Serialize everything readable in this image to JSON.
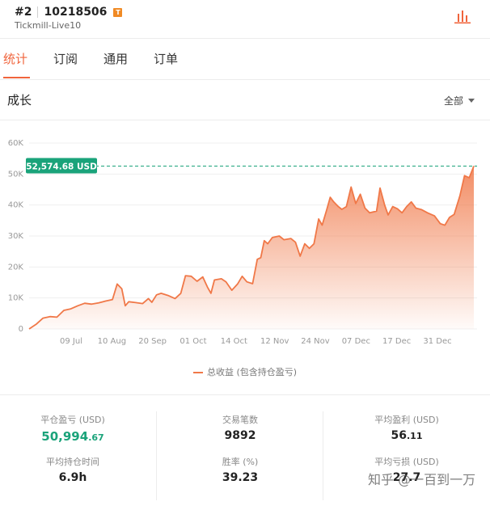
{
  "header": {
    "rank": "#2",
    "account_number": "10218506",
    "badge": "T",
    "broker": "Tickmill-Live10",
    "chart_icon": "bar-chart-icon"
  },
  "tabs": [
    {
      "label": "统计",
      "active": true
    },
    {
      "label": "订阅",
      "active": false
    },
    {
      "label": "通用",
      "active": false
    },
    {
      "label": "订单",
      "active": false
    }
  ],
  "section": {
    "title": "成长",
    "filter": "全部"
  },
  "colors": {
    "accent": "#f0643c",
    "line": "#f07848",
    "badge_bg": "#1aa37a",
    "gain": "#1aa37a"
  },
  "chart_data": {
    "type": "area",
    "current_value_label": "52,574.68 USD",
    "current_value": 52574.68,
    "ylim": [
      0,
      60000
    ],
    "yticks": [
      "0",
      "10K",
      "20K",
      "30K",
      "40K",
      "50K",
      "60K"
    ],
    "xtick_labels": [
      "09 Jul",
      "10 Aug",
      "20 Sep",
      "01 Oct",
      "14 Oct",
      "12 Nov",
      "24 Nov",
      "07 Dec",
      "17 Dec",
      "31 Dec"
    ],
    "legend": "总收益 (包含持仓盈亏)",
    "grid": true,
    "series": [
      {
        "name": "总收益 (包含持仓盈亏)",
        "points": [
          [
            0,
            0
          ],
          [
            0.6,
            1500
          ],
          [
            1.2,
            3500
          ],
          [
            1.8,
            4000
          ],
          [
            2.4,
            3800
          ],
          [
            3.0,
            6000
          ],
          [
            3.6,
            6500
          ],
          [
            4.2,
            7500
          ],
          [
            4.8,
            8300
          ],
          [
            5.4,
            8000
          ],
          [
            6.0,
            8400
          ],
          [
            6.6,
            9000
          ],
          [
            7.2,
            9500
          ],
          [
            7.6,
            14500
          ],
          [
            8.0,
            13000
          ],
          [
            8.3,
            7500
          ],
          [
            8.6,
            8800
          ],
          [
            9.2,
            8500
          ],
          [
            9.8,
            8200
          ],
          [
            10.3,
            9800
          ],
          [
            10.6,
            8600
          ],
          [
            11.0,
            11000
          ],
          [
            11.4,
            11500
          ],
          [
            12.0,
            10800
          ],
          [
            12.6,
            9800
          ],
          [
            13.1,
            11500
          ],
          [
            13.5,
            17200
          ],
          [
            14.0,
            17000
          ],
          [
            14.5,
            15400
          ],
          [
            15.0,
            16800
          ],
          [
            15.4,
            13500
          ],
          [
            15.7,
            11500
          ],
          [
            16.0,
            15800
          ],
          [
            16.6,
            16200
          ],
          [
            17.0,
            15200
          ],
          [
            17.5,
            12500
          ],
          [
            18.0,
            14500
          ],
          [
            18.4,
            17000
          ],
          [
            18.8,
            15200
          ],
          [
            19.3,
            14600
          ],
          [
            19.7,
            22500
          ],
          [
            20.0,
            23000
          ],
          [
            20.3,
            28500
          ],
          [
            20.6,
            27500
          ],
          [
            21.0,
            29500
          ],
          [
            21.6,
            30000
          ],
          [
            22.0,
            28800
          ],
          [
            22.6,
            29200
          ],
          [
            23.0,
            28000
          ],
          [
            23.4,
            23500
          ],
          [
            23.8,
            27500
          ],
          [
            24.2,
            26000
          ],
          [
            24.6,
            27500
          ],
          [
            25.0,
            35500
          ],
          [
            25.3,
            33500
          ],
          [
            25.7,
            38500
          ],
          [
            26.0,
            42500
          ],
          [
            26.3,
            41000
          ],
          [
            26.7,
            39500
          ],
          [
            27.0,
            38600
          ],
          [
            27.4,
            39500
          ],
          [
            27.8,
            45800
          ],
          [
            28.2,
            40500
          ],
          [
            28.6,
            43500
          ],
          [
            29.0,
            39000
          ],
          [
            29.4,
            37500
          ],
          [
            30.0,
            38000
          ],
          [
            30.3,
            45500
          ],
          [
            30.7,
            40000
          ],
          [
            31.0,
            36800
          ],
          [
            31.4,
            39500
          ],
          [
            31.8,
            38800
          ],
          [
            32.2,
            37500
          ],
          [
            32.6,
            39500
          ],
          [
            33.0,
            41000
          ],
          [
            33.4,
            39000
          ],
          [
            33.9,
            38500
          ],
          [
            34.4,
            37500
          ],
          [
            35.0,
            36500
          ],
          [
            35.5,
            34000
          ],
          [
            35.9,
            33500
          ],
          [
            36.3,
            36000
          ],
          [
            36.7,
            37000
          ],
          [
            37.2,
            43000
          ],
          [
            37.6,
            49500
          ],
          [
            38.0,
            48800
          ],
          [
            38.4,
            52600
          ]
        ]
      }
    ]
  },
  "stats": [
    {
      "label": "平仓盈亏 (USD)",
      "value_int": "50,994",
      "value_dec": ".67",
      "green": true
    },
    {
      "label": "交易笔数",
      "value": "9892"
    },
    {
      "label": "平均盈利 (USD)",
      "value_int": "56",
      "value_dec": ".11"
    },
    {
      "label": "平均持仓时间",
      "value": "6.9h"
    },
    {
      "label": "胜率 (%)",
      "value": "39.23"
    },
    {
      "label": "平均亏损 (USD)",
      "value": "27.7"
    }
  ],
  "watermark": "知乎 @一百到一万"
}
